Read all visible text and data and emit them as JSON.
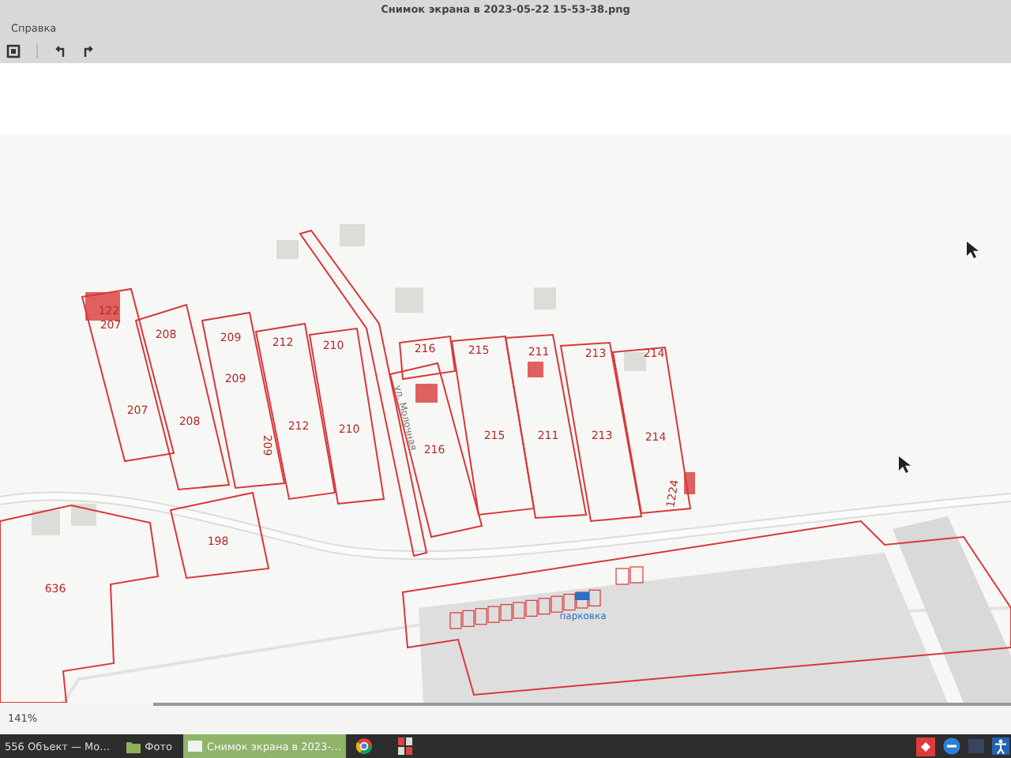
{
  "window": {
    "title": "Снимок экрана в 2023-05-22 15-53-38.png"
  },
  "menu": [
    {
      "label": "Справка"
    }
  ],
  "map": {
    "labels": [
      "122",
      "207",
      "208",
      "209",
      "212",
      "210",
      "216",
      "215",
      "211",
      "213",
      "214",
      "209",
      "207",
      "208",
      "212",
      "210",
      "216",
      "215",
      "211",
      "213",
      "214",
      "209",
      "1224",
      "198",
      "636"
    ],
    "street_label": "ул. Молочная",
    "parking_label": "парковка"
  },
  "status_bar": {
    "zoom": "141%"
  },
  "taskbar": {
    "tasks": [
      {
        "label": "556 Объект — Мо…",
        "selected": false,
        "kind": "text"
      },
      {
        "label": "Фото",
        "selected": false,
        "kind": "folder"
      },
      {
        "label": "Снимок экрана в 2023-…",
        "selected": true,
        "kind": "image"
      }
    ]
  }
}
